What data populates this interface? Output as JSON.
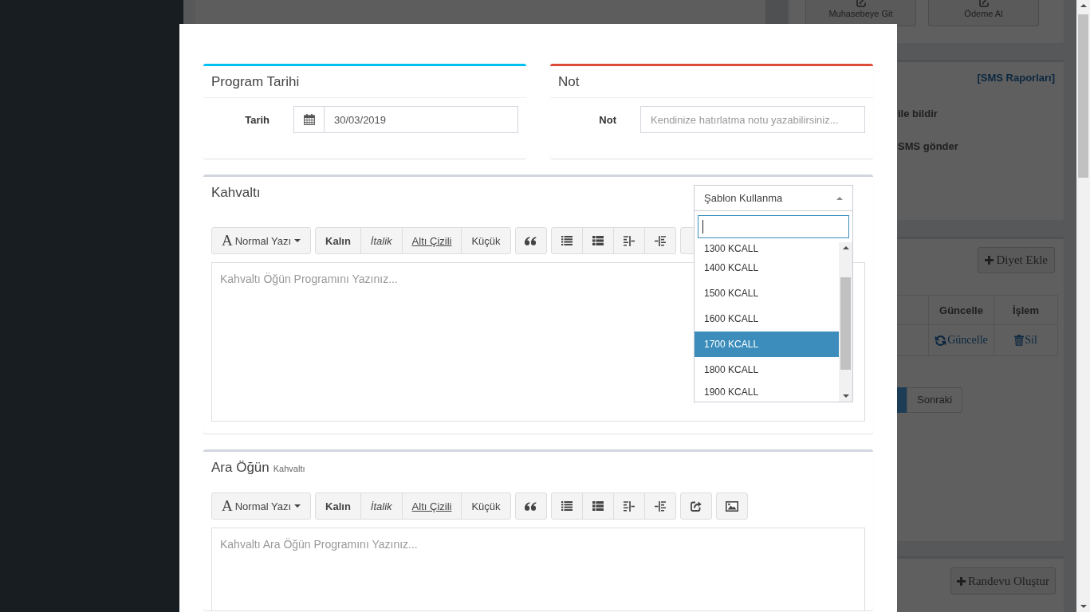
{
  "page": {
    "top_buttons": [
      {
        "label": "Muhasebeye Git"
      },
      {
        "label": "Ödeme Al"
      }
    ],
    "notify_panel": {
      "link": "[SMS Raporları]",
      "options": [
        {
          "label": "ile bildir"
        },
        {
          "label": "SMS gönder"
        }
      ]
    },
    "diet_panel": {
      "add_button": "Diyet Ekle",
      "table": {
        "columns": [
          "Güncelle",
          "İşlem"
        ],
        "rows": [
          {
            "cells": [
              {
                "kind": "update",
                "label": "Güncelle"
              },
              {
                "kind": "delete",
                "label": "Sil"
              }
            ]
          }
        ]
      },
      "pagination": [
        {
          "kind": "page",
          "selected": true
        },
        {
          "kind": "next",
          "label": "Sonraki",
          "selected": false
        }
      ]
    },
    "appointment_panel": {
      "button": "Randevu Oluştur"
    }
  },
  "modal": {
    "top_panels": [
      {
        "kind": "date",
        "title": "Program Tarihi",
        "color": "#00c0ef",
        "label": "Tarih",
        "value": "30/03/2019"
      },
      {
        "kind": "note",
        "title": "Not",
        "color": "#dd4b39",
        "label": "Not",
        "placeholder": "Kendinize hatırlatma notu yazabilirsiniz..."
      }
    ],
    "meals": [
      {
        "title": "Kahvaltı",
        "template_select": {
          "label": "Şablon Kullanma",
          "open": true,
          "search": {
            "focused": true
          },
          "options": [
            {
              "label": "1300 KCALL",
              "selected": false
            },
            {
              "label": "1400 KCALL",
              "selected": false
            },
            {
              "label": "1500 KCALL",
              "selected": false
            },
            {
              "label": "1600 KCALL",
              "selected": false
            },
            {
              "label": "1700 KCALL",
              "selected": true
            },
            {
              "label": "1800 KCALL",
              "selected": false
            },
            {
              "label": "1900 KCALL",
              "selected": false
            }
          ]
        },
        "toolbar": {
          "style_glyph": "A",
          "style_label": "Normal Yazı",
          "format_buttons": [
            {
              "kind": "bold",
              "label": "Kalın"
            },
            {
              "kind": "italic",
              "label": "İtalik"
            },
            {
              "kind": "underline",
              "label": "Altı Çizili"
            },
            {
              "kind": "small",
              "label": "Küçük"
            }
          ]
        },
        "placeholder": "Kahvaltı Öğün Programını Yazınız..."
      },
      {
        "title": "Ara Öğün",
        "subtitle": "Kahvaltı",
        "toolbar": {
          "style_glyph": "A",
          "style_label": "Normal Yazı",
          "format_buttons": [
            {
              "kind": "bold",
              "label": "Kalın"
            },
            {
              "kind": "italic",
              "label": "İtalik"
            },
            {
              "kind": "underline",
              "label": "Altı Çizili"
            },
            {
              "kind": "small",
              "label": "Küçük"
            }
          ]
        },
        "placeholder": "Kahvaltı Ara Öğün Programını Yazınız..."
      }
    ]
  }
}
